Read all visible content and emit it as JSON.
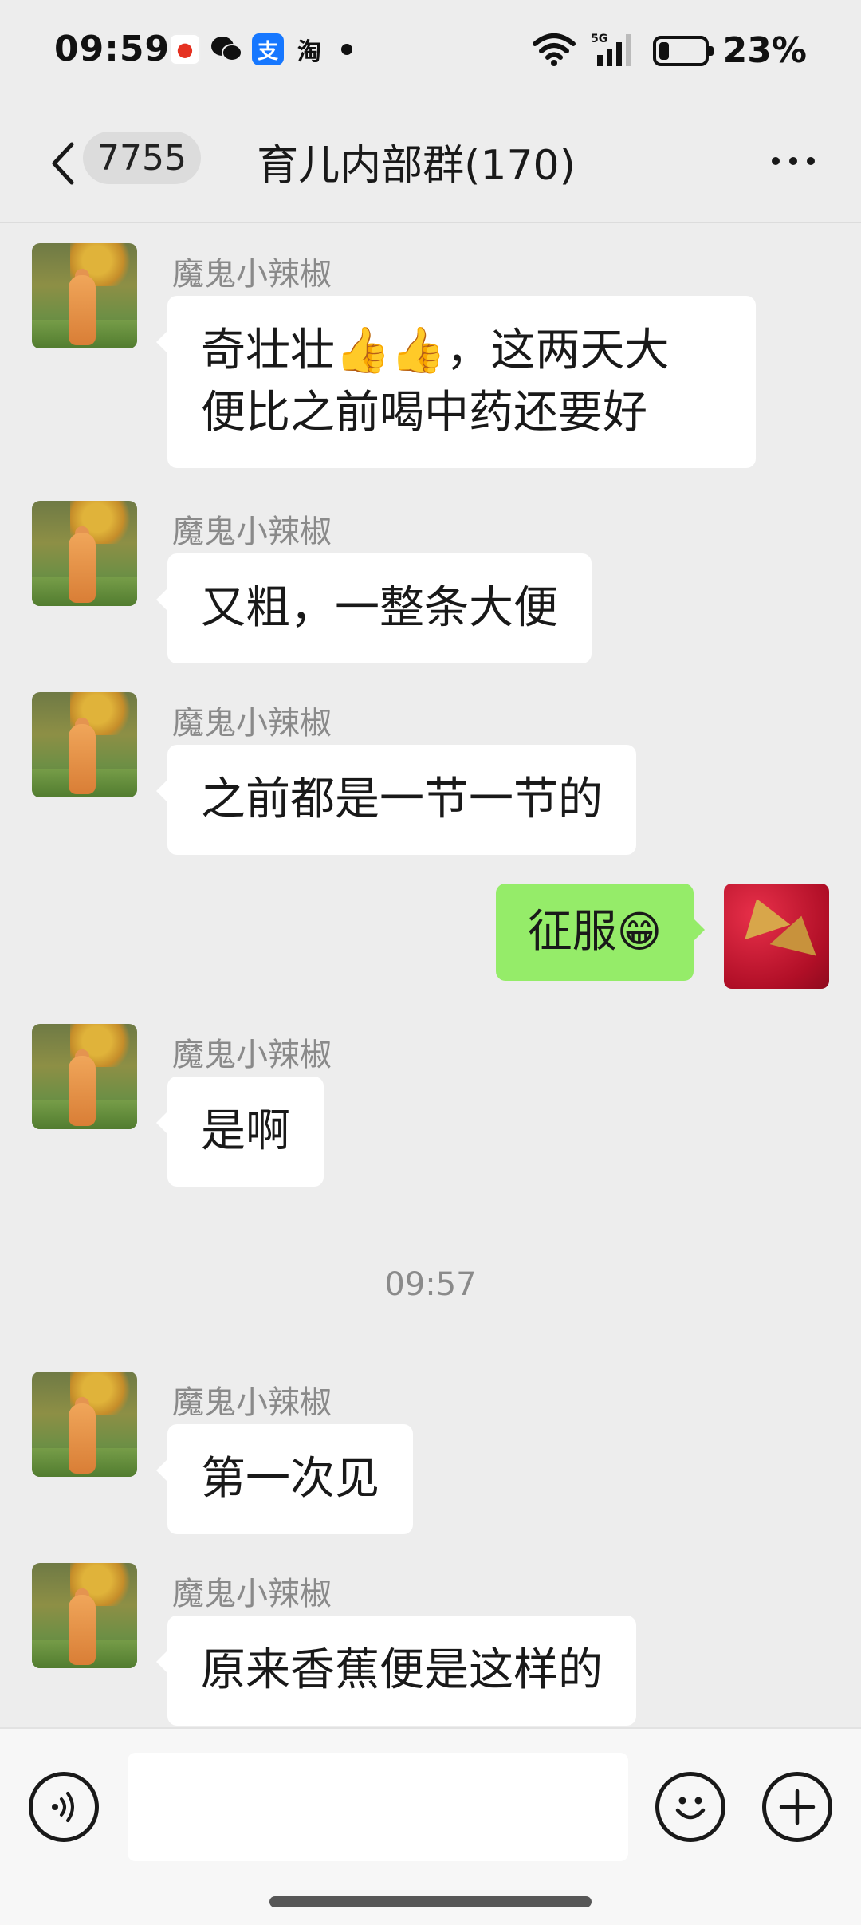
{
  "status_bar": {
    "time": "09:59",
    "notification_icons": [
      "news-app-icon",
      "wechat-icon",
      "alipay-icon",
      "taobao-icon"
    ],
    "alipay_glyph": "支",
    "taobao_glyph": "淘",
    "network_label": "5G",
    "battery_level_percent": 23,
    "battery_text": "23%"
  },
  "header": {
    "unread_count": "7755",
    "title": "育儿内部群(170)"
  },
  "messages": [
    {
      "sender": "魔鬼小辣椒",
      "lines": [
        "奇壮壮👍👍，这两天大",
        "便比之前喝中药还要好"
      ]
    },
    {
      "sender": "魔鬼小辣椒",
      "lines": [
        "又粗，一整条大便"
      ]
    },
    {
      "sender": "魔鬼小辣椒",
      "lines": [
        "之前都是一节一节的"
      ]
    },
    {
      "mine": true,
      "text": "征服",
      "emoji": "😁"
    },
    {
      "sender": "魔鬼小辣椒",
      "lines": [
        "是啊"
      ]
    },
    {
      "timestamp": "09:57"
    },
    {
      "sender": "魔鬼小辣椒",
      "lines": [
        "第一次见"
      ]
    },
    {
      "sender": "魔鬼小辣椒",
      "lines": [
        "原来香蕉便是这样的"
      ]
    }
  ],
  "input_bar": {
    "input_value": ""
  },
  "colors": {
    "background": "#ededed",
    "bubble_other": "#ffffff",
    "bubble_mine": "#95ec69",
    "sender_name": "#8a8a8a"
  }
}
